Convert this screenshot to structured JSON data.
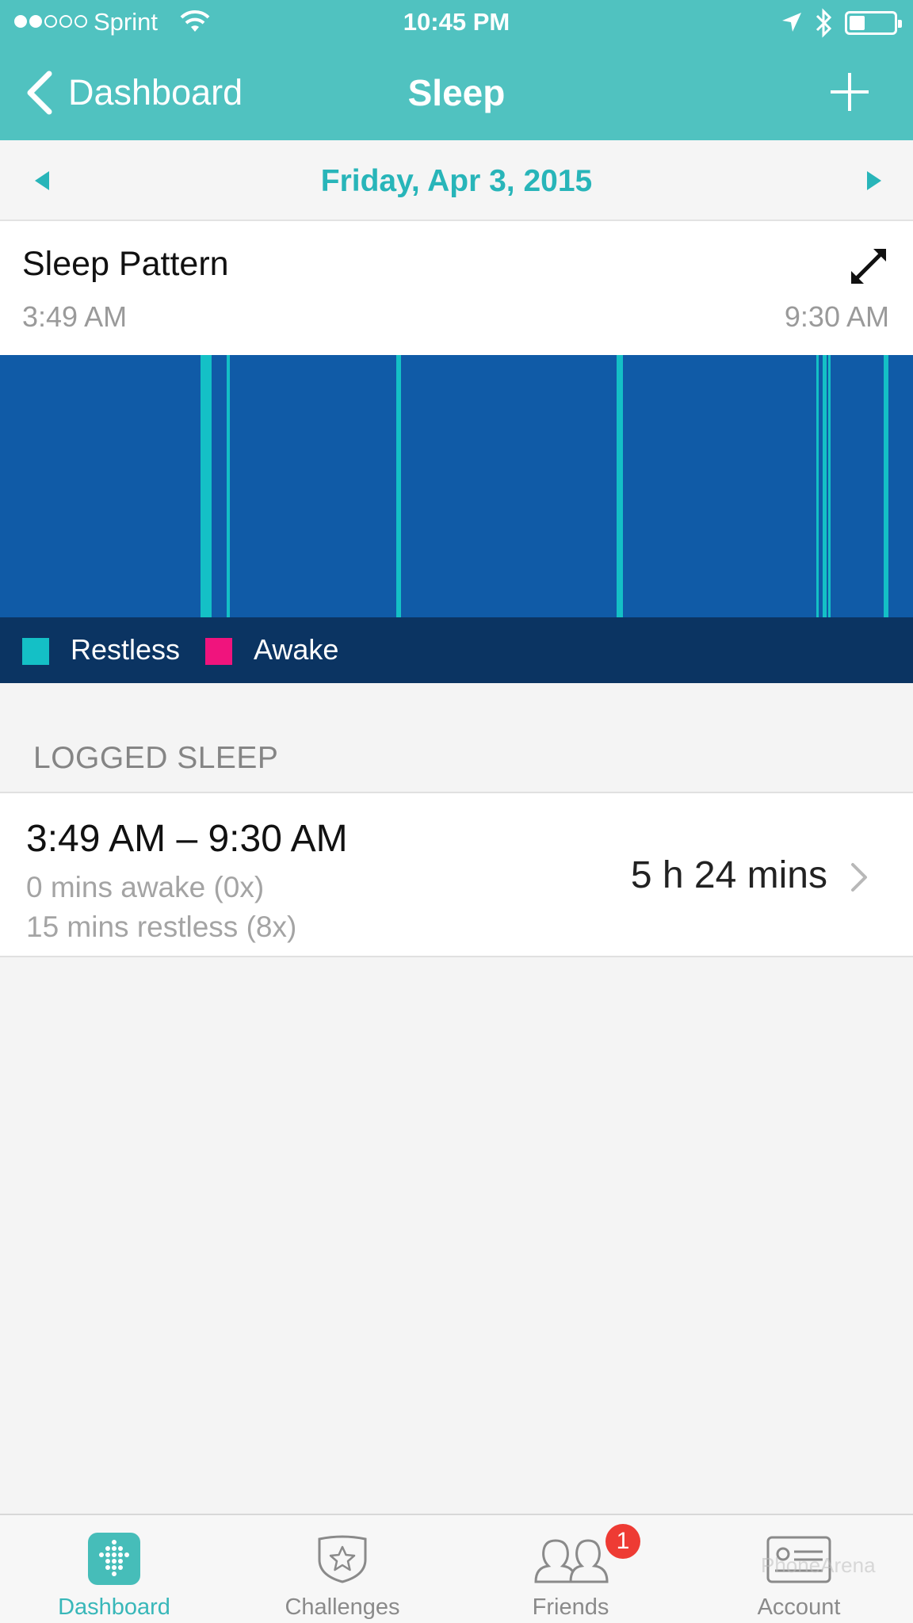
{
  "status_bar": {
    "carrier": "Sprint",
    "time": "10:45 PM",
    "signal_bars_filled": 2,
    "signal_bars_total": 5,
    "battery_level": 0.35,
    "icons": [
      "wifi-icon",
      "location-arrow-icon",
      "bluetooth-icon",
      "battery-icon"
    ]
  },
  "nav": {
    "back_label": "Dashboard",
    "title": "Sleep",
    "add_icon": "plus-icon"
  },
  "date_bar": {
    "date": "Friday, Apr 3, 2015",
    "prev_icon": "triangle-left-icon",
    "next_icon": "triangle-right-icon"
  },
  "pattern": {
    "title": "Sleep Pattern",
    "start_time": "3:49 AM",
    "end_time": "9:30 AM",
    "expand_icon": "expand-arrows-icon"
  },
  "legend": {
    "restless_label": "Restless",
    "awake_label": "Awake"
  },
  "colors": {
    "accent": "#50c2c0",
    "date_text": "#28b5b9",
    "asleep": "#105ba7",
    "restless": "#14c0c6",
    "awake": "#f0147d",
    "legend_bg": "#0b3462",
    "badge": "#ee3b34"
  },
  "logged_sleep": {
    "section_label": "LOGGED SLEEP",
    "entries": [
      {
        "range": "3:49 AM – 9:30 AM",
        "awake": "0 mins awake (0x)",
        "restless": "15 mins restless (8x)",
        "duration": "5 h 24 mins"
      }
    ]
  },
  "tabs": [
    {
      "label": "Dashboard",
      "icon": "fitbit-dots-icon",
      "active": true
    },
    {
      "label": "Challenges",
      "icon": "star-shield-icon",
      "active": false
    },
    {
      "label": "Friends",
      "icon": "people-icon",
      "active": false,
      "badge": "1"
    },
    {
      "label": "Account",
      "icon": "id-card-icon",
      "active": false
    }
  ],
  "watermark": "PhoneArena"
}
